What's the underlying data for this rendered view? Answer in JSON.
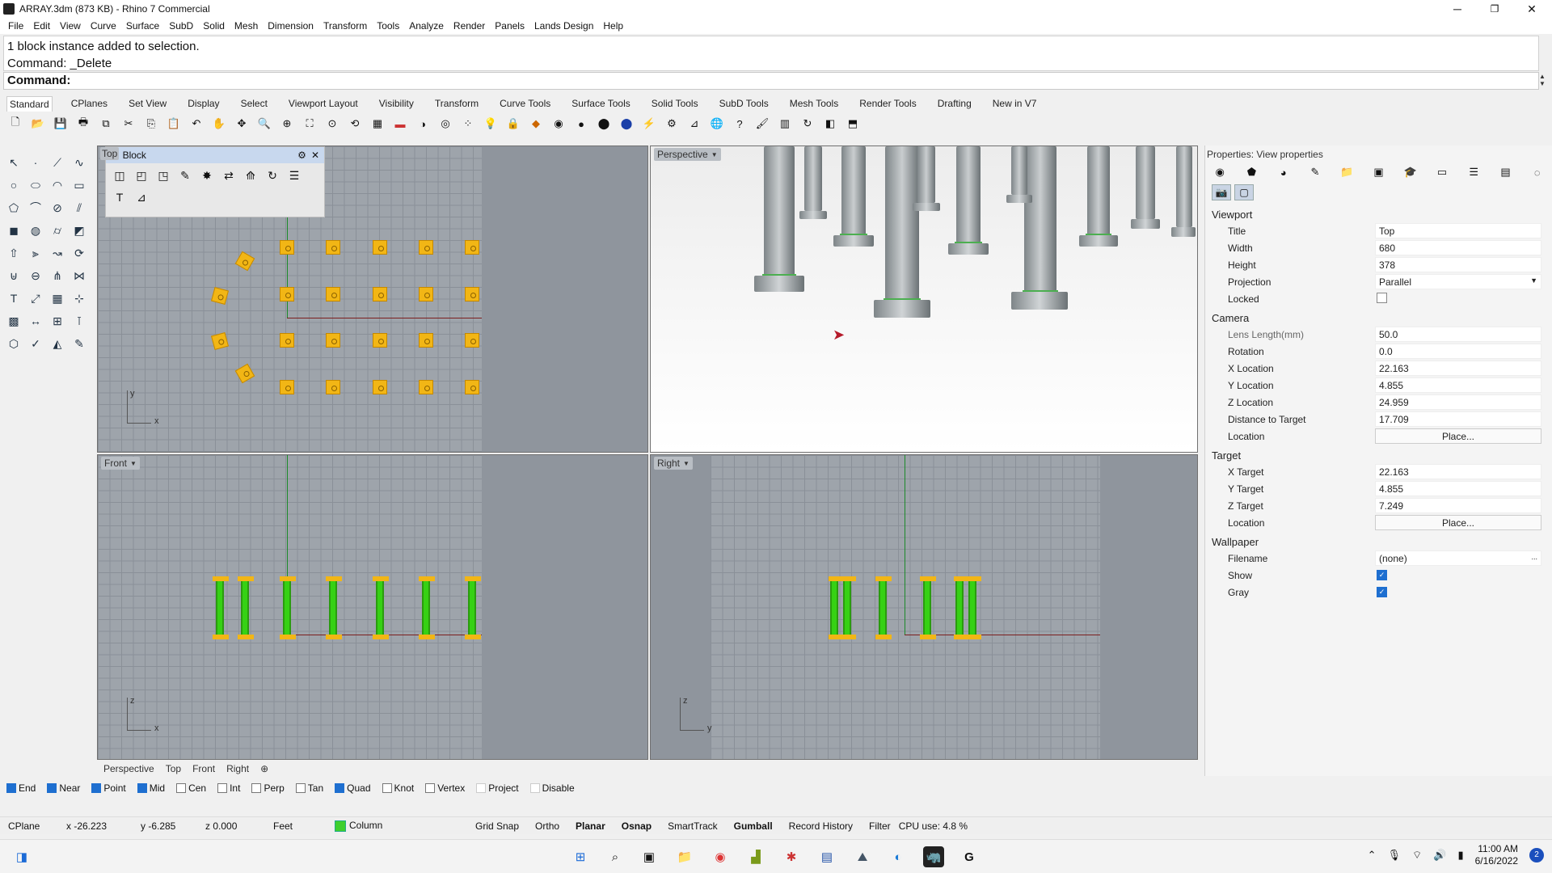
{
  "window": {
    "title": "ARRAY.3dm (873 KB) - Rhino 7 Commercial",
    "minimize": "─",
    "restore": "❐",
    "close": "✕"
  },
  "menu": [
    "File",
    "Edit",
    "View",
    "Curve",
    "Surface",
    "SubD",
    "Solid",
    "Mesh",
    "Dimension",
    "Transform",
    "Tools",
    "Analyze",
    "Render",
    "Panels",
    "Lands Design",
    "Help"
  ],
  "command": {
    "history_line1": "1 block instance added to selection.",
    "history_line2": "Command: _Delete",
    "prompt": "Command:"
  },
  "toolbar_tabs": [
    "Standard",
    "CPlanes",
    "Set View",
    "Display",
    "Select",
    "Viewport Layout",
    "Visibility",
    "Transform",
    "Curve Tools",
    "Surface Tools",
    "Solid Tools",
    "SubD Tools",
    "Mesh Tools",
    "Render Tools",
    "Drafting",
    "New in V7"
  ],
  "block_panel": {
    "title": "Block"
  },
  "viewports": {
    "top": {
      "label": "Top"
    },
    "perspective": {
      "label": "Perspective"
    },
    "front": {
      "label": "Front"
    },
    "right": {
      "label": "Right"
    }
  },
  "axis_labels": {
    "top_y": "y",
    "top_x": "x",
    "front_z": "z",
    "front_x": "x",
    "right_z": "z",
    "right_y": "y"
  },
  "viewport_tabs": [
    "Perspective",
    "Top",
    "Front",
    "Right"
  ],
  "properties": {
    "header": "Properties: View properties",
    "viewport_section": "Viewport",
    "camera_section": "Camera",
    "target_section": "Target",
    "wallpaper_section": "Wallpaper",
    "viewport": [
      {
        "k": "Title",
        "v": "Top"
      },
      {
        "k": "Width",
        "v": "680"
      },
      {
        "k": "Height",
        "v": "378"
      },
      {
        "k": "Projection",
        "v": "Parallel"
      }
    ],
    "locked_label": "Locked",
    "camera": [
      {
        "k": "Lens Length(mm)",
        "v": "50.0"
      },
      {
        "k": "Rotation",
        "v": "0.0"
      },
      {
        "k": "X Location",
        "v": "22.163"
      },
      {
        "k": "Y Location",
        "v": "4.855"
      },
      {
        "k": "Z Location",
        "v": "24.959"
      },
      {
        "k": "Distance to Target",
        "v": "17.709"
      }
    ],
    "camera_location_label": "Location",
    "place_button": "Place...",
    "target": [
      {
        "k": "X Target",
        "v": "22.163"
      },
      {
        "k": "Y Target",
        "v": "4.855"
      },
      {
        "k": "Z Target",
        "v": "7.249"
      }
    ],
    "target_location_label": "Location",
    "filename_label": "Filename",
    "filename_value": "(none)",
    "filename_browse": "...",
    "show_label": "Show",
    "gray_label": "Gray"
  },
  "osnap": [
    {
      "label": "End",
      "on": true
    },
    {
      "label": "Near",
      "on": true
    },
    {
      "label": "Point",
      "on": true
    },
    {
      "label": "Mid",
      "on": true
    },
    {
      "label": "Cen",
      "on": false
    },
    {
      "label": "Int",
      "on": false
    },
    {
      "label": "Perp",
      "on": false
    },
    {
      "label": "Tan",
      "on": false
    },
    {
      "label": "Quad",
      "on": true
    },
    {
      "label": "Knot",
      "on": false
    },
    {
      "label": "Vertex",
      "on": false
    },
    {
      "label": "Project",
      "on": false
    },
    {
      "label": "Disable",
      "on": false
    }
  ],
  "status": {
    "cplane": "CPlane",
    "x": "x -26.223",
    "y": "y -6.285",
    "z": "z 0.000",
    "units": "Feet",
    "layer": "Column",
    "layer_color": "#3ecf2e",
    "grid_snap": "Grid Snap",
    "ortho": "Ortho",
    "planar": "Planar",
    "osnap": "Osnap",
    "smarttrack": "SmartTrack",
    "gumball": "Gumball",
    "record_history": "Record History",
    "filter": "Filter",
    "cpu": "CPU use: 4.8 %"
  },
  "taskbar": {
    "time": "11:00 AM",
    "date": "6/16/2022",
    "notifications": "2"
  }
}
